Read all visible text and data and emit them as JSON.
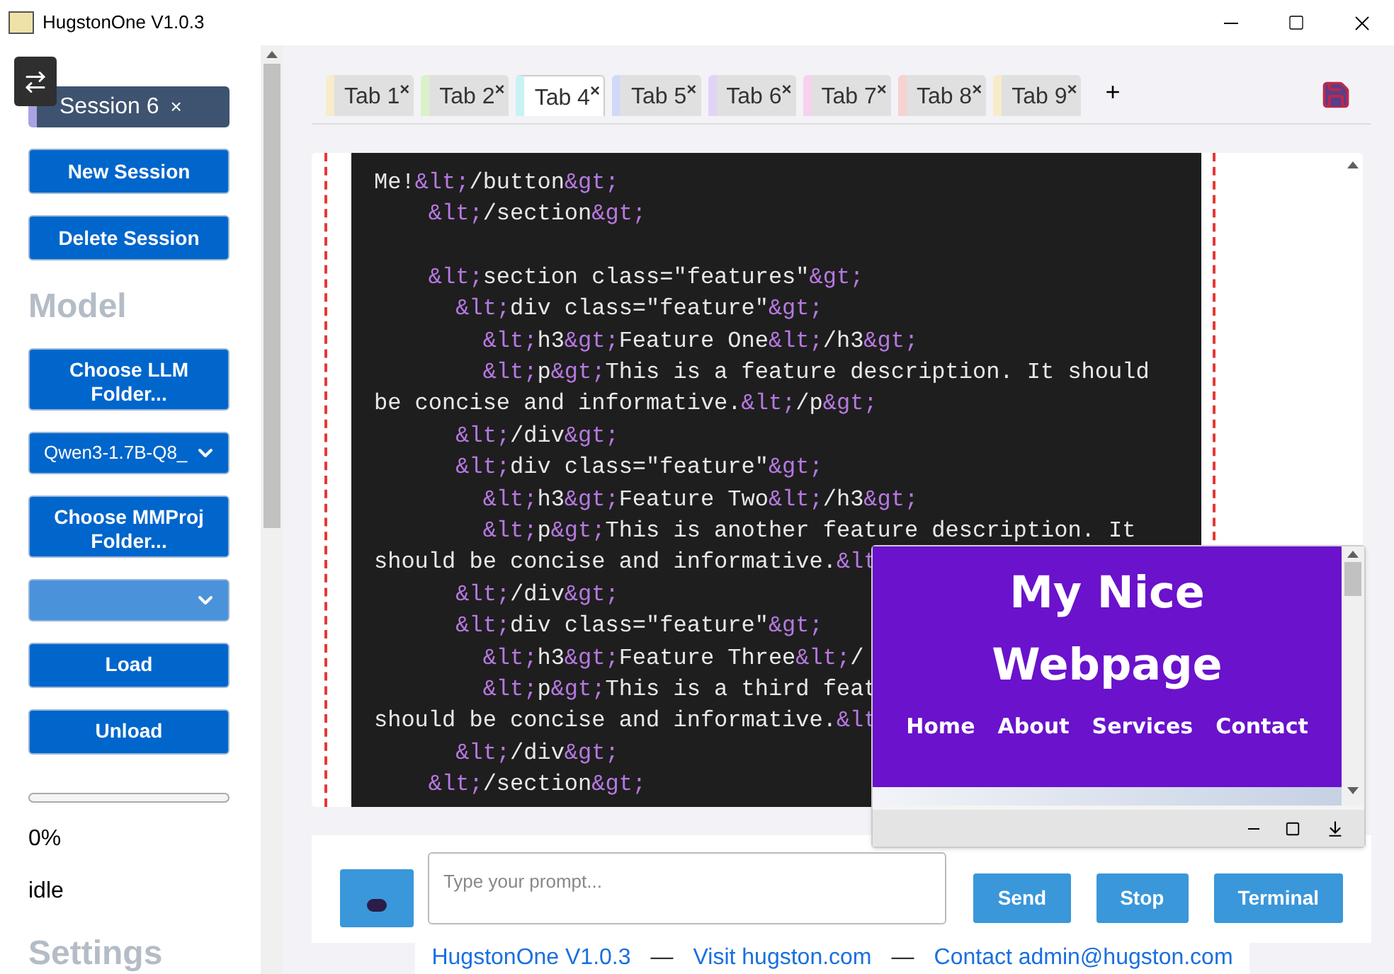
{
  "window": {
    "title": "HugstonOne V1.0.3"
  },
  "sidebar": {
    "sessions": [
      {
        "label": "Session 6",
        "close": "×",
        "selected": true
      }
    ],
    "items": [
      {
        "kind": "button",
        "label": "New Session"
      },
      {
        "kind": "button",
        "label": "Delete Session"
      },
      {
        "kind": "heading",
        "label": "Model"
      },
      {
        "kind": "button",
        "label": "Choose LLM Folder..."
      },
      {
        "kind": "select",
        "value": "Qwen3-1.7B-Q8_"
      },
      {
        "kind": "button",
        "label": "Choose MMProj Folder..."
      },
      {
        "kind": "select",
        "disabled": true
      },
      {
        "kind": "button",
        "label": "Load"
      },
      {
        "kind": "button",
        "label": "Unload"
      },
      {
        "kind": "progress",
        "level": 0
      },
      {
        "kind": "text",
        "label": "0%"
      },
      {
        "kind": "text",
        "label": "idle"
      },
      {
        "kind": "heading",
        "label": "Settings"
      }
    ]
  },
  "tabs": [
    {
      "label": "Tab 1",
      "close": "×",
      "color": "#f7eccb",
      "selected": false
    },
    {
      "label": "Tab 2",
      "close": "×",
      "color": "#d9f2c9",
      "selected": false
    },
    {
      "label": "Tab 4",
      "close": "×",
      "color": "#c9f2f2",
      "selected": true
    },
    {
      "label": "Tab 5",
      "close": "×",
      "color": "#d2d9f7",
      "selected": false
    },
    {
      "label": "Tab 6",
      "close": "×",
      "color": "#e2d2f7",
      "selected": false
    },
    {
      "label": "Tab 7",
      "close": "×",
      "color": "#f7d2ee",
      "selected": false
    },
    {
      "label": "Tab 8",
      "close": "×",
      "color": "#f7d2d2",
      "selected": false
    },
    {
      "label": "Tab 9",
      "close": "×",
      "color": "#f7ebc9",
      "selected": false
    }
  ],
  "add_tab": "+",
  "editor": {
    "lines": [
      {
        "kind": "code",
        "text": "Me!&lt;/button&gt;"
      },
      {
        "kind": "code",
        "text": "    &lt;/section&gt;"
      },
      {
        "kind": "blank"
      },
      {
        "kind": "code",
        "text": "    &lt;section class=\"features\"&gt;"
      },
      {
        "kind": "code",
        "text": "      &lt;div class=\"feature\"&gt;"
      },
      {
        "kind": "code",
        "text": "        &lt;h3&gt;Feature One&lt;/h3&gt;"
      },
      {
        "kind": "code",
        "text": "        &lt;p&gt;This is a feature description. It should"
      },
      {
        "kind": "code",
        "text": "be concise and informative.&lt;/p&gt;"
      },
      {
        "kind": "code",
        "text": "      &lt;/div&gt;"
      },
      {
        "kind": "code",
        "text": "      &lt;div class=\"feature\"&gt;"
      },
      {
        "kind": "code",
        "text": "        &lt;h3&gt;Feature Two&lt;/h3&gt;"
      },
      {
        "kind": "code",
        "text": "        &lt;p&gt;This is another feature description. It"
      },
      {
        "kind": "code",
        "text": "should be concise and informative.&lt"
      },
      {
        "kind": "code",
        "text": "      &lt;/div&gt;"
      },
      {
        "kind": "code",
        "text": "      &lt;div class=\"feature\"&gt;"
      },
      {
        "kind": "code",
        "text": "        &lt;h3&gt;Feature Three&lt;/"
      },
      {
        "kind": "code",
        "text": "        &lt;p&gt;This is a third feat"
      },
      {
        "kind": "code",
        "text": "should be concise and informative.&lt"
      },
      {
        "kind": "code",
        "text": "      &lt;/div&gt;"
      },
      {
        "kind": "code",
        "text": "    &lt;/section&gt;"
      }
    ]
  },
  "preview": {
    "heading": "My Nice Webpage",
    "nav": [
      "Home",
      "About",
      "Services",
      "Contact"
    ]
  },
  "prompt": {
    "placeholder": "Type your prompt..."
  },
  "actions": [
    "Send",
    "Stop",
    "Terminal"
  ],
  "footer": [
    {
      "kind": "link",
      "text": "HugstonOne V1.0.3"
    },
    {
      "kind": "separator",
      "text": "—"
    },
    {
      "kind": "link",
      "text": "Visit hugston.com"
    },
    {
      "kind": "separator",
      "text": "—"
    },
    {
      "kind": "link",
      "text": "Contact admin@hugston.com"
    }
  ]
}
